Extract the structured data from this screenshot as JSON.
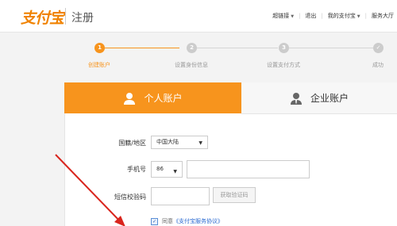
{
  "header": {
    "logo": "支付宝",
    "title": "注册",
    "nav": [
      "超链接",
      "退出",
      "我的支付宝",
      "服务大厅"
    ]
  },
  "steps": [
    {
      "num": "1",
      "label": "创建账户",
      "active": true
    },
    {
      "num": "2",
      "label": "设置身份信息",
      "active": false
    },
    {
      "num": "3",
      "label": "设置支付方式",
      "active": false
    },
    {
      "num": "✓",
      "label": "成功",
      "active": false
    }
  ],
  "tabs": {
    "personal": "个人账户",
    "enterprise": "企业账户"
  },
  "form": {
    "region_label": "国籍/地区",
    "region_value": "中国大陆",
    "phone_label": "手机号",
    "phone_code": "86",
    "phone_value": "",
    "sms_label": "短信校验码",
    "sms_value": "",
    "get_code_label": "获取验证码",
    "agree_prefix": "同意",
    "agree_link": "《支付宝服务协议》"
  },
  "colors": {
    "accent": "#f7941d",
    "logo": "#f08200",
    "annotation": "#d9251d"
  }
}
